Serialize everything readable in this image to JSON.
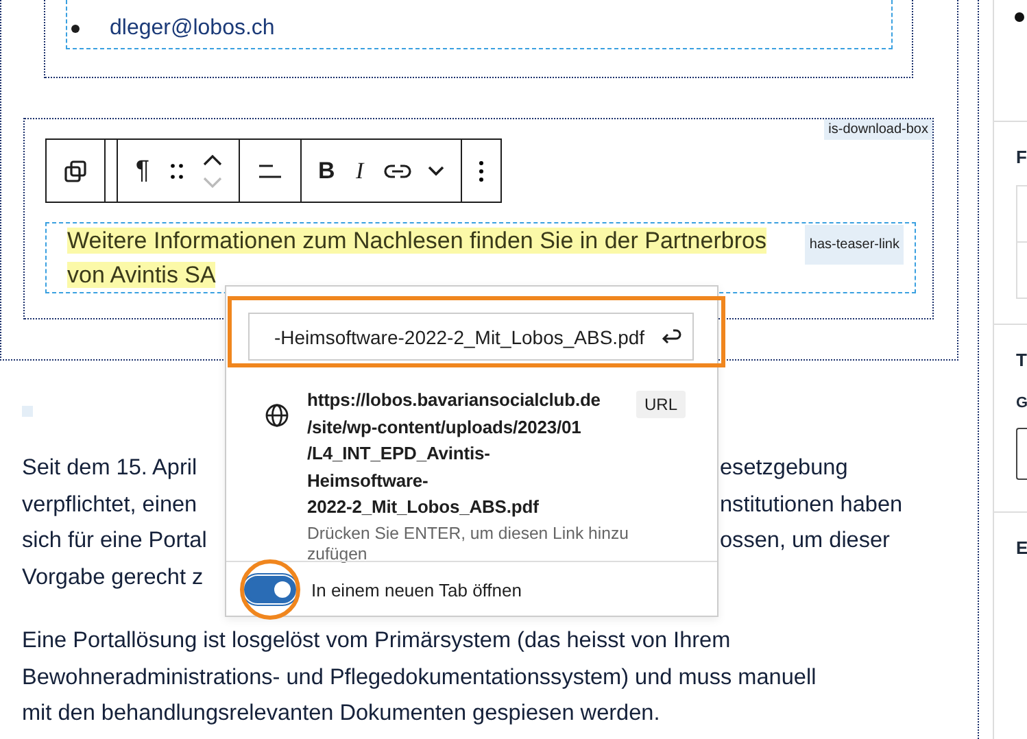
{
  "contacts": {
    "email": "dleger@lobos.ch"
  },
  "download_box": {
    "tag": "is-download-box",
    "teaser_lines": [
      "Weitere Informationen zum Nachlesen finden Sie in der Partnerbros",
      "von Avintis SA"
    ],
    "teaser_tag": "has-teaser-link"
  },
  "toolbar": {
    "paragraph": "¶",
    "bold": "B",
    "italic": "I"
  },
  "link_popover": {
    "input_value": "-Heimsoftware-2022-2_Mit_Lobos_ABS.pdf",
    "url_lines": [
      "https://lobos.bavariansocialclub.de",
      "/site/wp-content/uploads/2023/01",
      "/L4_INT_EPD_Avintis-",
      "Heimsoftware-",
      "2022-2_Mit_Lobos_ABS.pdf"
    ],
    "badge": "URL",
    "hint_lines": [
      "Drücken Sie ENTER, um diesen Link hinzu",
      "zufügen"
    ],
    "new_tab": {
      "label": "In einem neuen Tab öffnen",
      "on": true
    }
  },
  "body": {
    "paragraphs": [
      {
        "lines": [
          {
            "left": "Seit dem 15. April",
            "right": "esetzgebung"
          },
          {
            "left": "verpflichtet, einen",
            "right": "nstitutionen haben"
          },
          {
            "left": "sich für eine Portal",
            "right": "ossen, um dieser"
          },
          {
            "left": "Vorgabe gerecht z"
          }
        ]
      },
      {
        "lines": [
          {
            "left": "Eine Portallösung ist losgelöst vom Primärsystem (das heisst von Ihrem"
          },
          {
            "left": "Bewohneradministrations- und Pflegedokumentationssystem) und muss manuell"
          },
          {
            "left": "mit den behandlungsrelevanten Dokumenten gespiesen werden."
          }
        ]
      }
    ]
  },
  "sidebar": {
    "sections": [
      {
        "heading": "F"
      },
      {
        "heading": "T",
        "label": "G"
      },
      {
        "heading": "E"
      }
    ]
  }
}
